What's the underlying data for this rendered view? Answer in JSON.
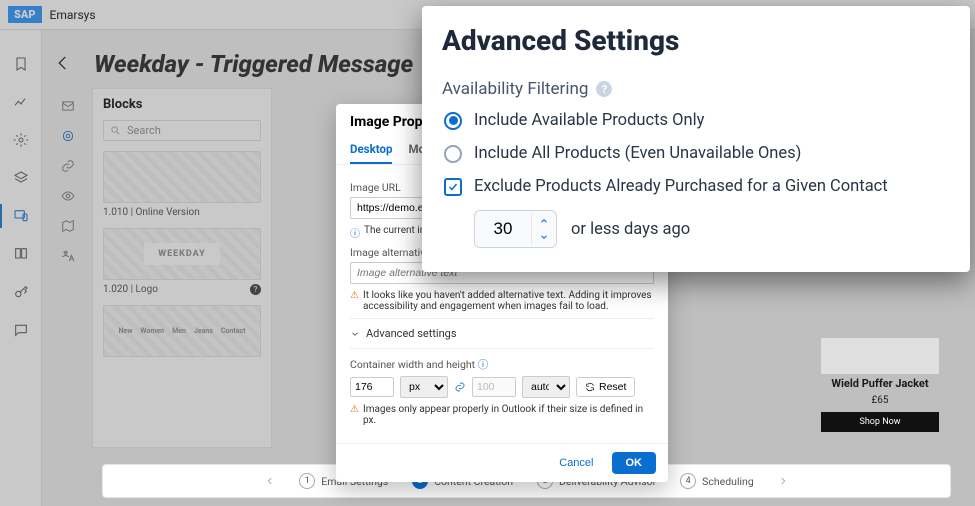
{
  "header": {
    "brand": "SAP",
    "product": "Emarsys"
  },
  "page": {
    "title": "Weekday - Triggered Message"
  },
  "blocks": {
    "label": "Blocks",
    "search_placeholder": "Search",
    "items": [
      {
        "caption": "1.010 | Online Version",
        "thumb_text": ""
      },
      {
        "caption": "1.020 | Logo",
        "thumb_text": "WEEKDAY"
      }
    ],
    "nav_preview": [
      "New",
      "Women",
      "Men",
      "Jeans",
      "Contact"
    ]
  },
  "image_props": {
    "title": "Image Properties",
    "tabs": [
      "Desktop",
      "Mobile"
    ],
    "url_label": "Image URL",
    "url_value": "https://demo.emarsys",
    "note_info": "The current image dimensions",
    "alt_label": "Image alternative text",
    "alt_placeholder": "Image alternative text",
    "note_warn": "It looks like you haven't added alternative text. Adding it improves accessibility and engagement when images fail to load.",
    "adv_label": "Advanced settings",
    "dim_label": "Container width and height",
    "width": "176",
    "width_unit": "px",
    "height": "100",
    "height_unit": "auto",
    "reset": "Reset",
    "note_outlook": "Images only appear properly in Outlook if their size is defined in px.",
    "cancel": "Cancel",
    "ok": "OK"
  },
  "product": {
    "name": "Wield Puffer Jacket",
    "price": "£65",
    "cta": "Shop Now"
  },
  "stepper": {
    "steps": [
      "Email Settings",
      "Content Creation",
      "Deliverability Advisor",
      "Scheduling"
    ]
  },
  "advanced": {
    "title": "Advanced Settings",
    "section": "Availability Filtering",
    "opt_available": "Include Available Products Only",
    "opt_all": "Include All Products (Even Unavailable Ones)",
    "check_exclude": "Exclude Products Already Purchased for a Given Contact",
    "days": "30",
    "days_suffix": "or less days ago"
  }
}
